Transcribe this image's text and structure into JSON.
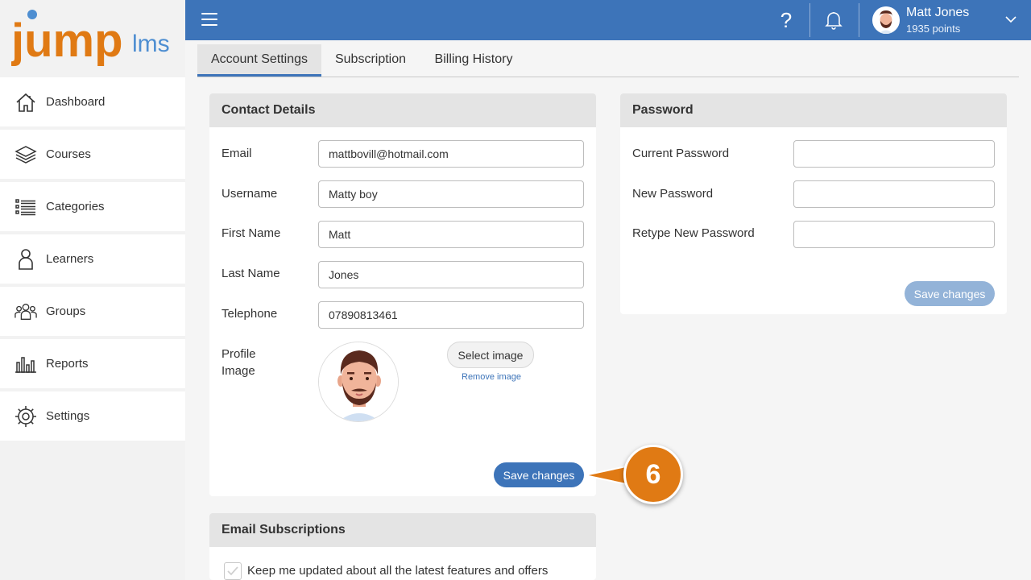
{
  "logo": {
    "text_main": "jump",
    "text_suffix": "lms"
  },
  "sidebar": {
    "items": [
      {
        "label": "Dashboard",
        "icon": "home-icon"
      },
      {
        "label": "Courses",
        "icon": "books-icon"
      },
      {
        "label": "Categories",
        "icon": "list-icon"
      },
      {
        "label": "Learners",
        "icon": "person-icon"
      },
      {
        "label": "Groups",
        "icon": "group-icon"
      },
      {
        "label": "Reports",
        "icon": "bar-chart-icon"
      },
      {
        "label": "Settings",
        "icon": "gear-icon"
      }
    ]
  },
  "topbar": {
    "help_symbol": "?",
    "user_name": "Matt Jones",
    "user_points": "1935 points"
  },
  "tabs": [
    {
      "label": "Account Settings",
      "active": true
    },
    {
      "label": "Subscription",
      "active": false
    },
    {
      "label": "Billing History",
      "active": false
    }
  ],
  "contact": {
    "title": "Contact Details",
    "email_label": "Email",
    "email_value": "mattbovill@hotmail.com",
    "username_label": "Username",
    "username_value": "Matty boy",
    "first_name_label": "First Name",
    "first_name_value": "Matt",
    "last_name_label": "Last Name",
    "last_name_value": "Jones",
    "telephone_label": "Telephone",
    "telephone_value": "07890813461",
    "profile_label_line1": "Profile",
    "profile_label_line2": "Image",
    "select_image_label": "Select image",
    "remove_image_label": "Remove image",
    "save_label": "Save changes"
  },
  "password": {
    "title": "Password",
    "current_label": "Current Password",
    "new_label": "New Password",
    "retype_label": "Retype New Password",
    "save_label": "Save changes"
  },
  "email_subscriptions": {
    "title": "Email Subscriptions",
    "option_label": "Keep me updated about all the latest features and offers",
    "option_checked": true
  },
  "callout": {
    "number": "6"
  },
  "colors": {
    "primary": "#3d74b9",
    "callout": "#e07a14",
    "logo_orange": "#e07a14",
    "logo_blue": "#4e8ed1"
  }
}
